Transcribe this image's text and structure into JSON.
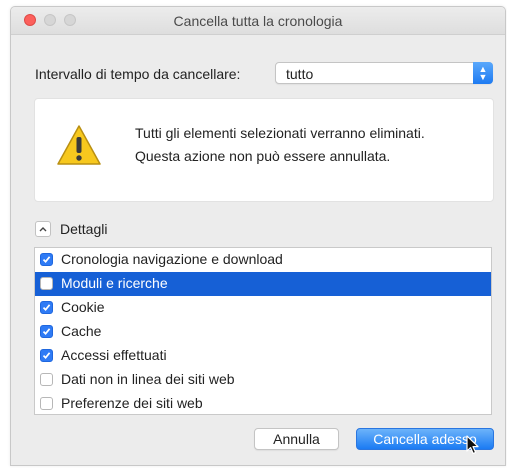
{
  "window": {
    "title": "Cancella tutta la cronologia"
  },
  "range": {
    "label": "Intervallo di tempo da cancellare:",
    "selected": "tutto"
  },
  "warning": {
    "line1": "Tutti gli elementi selezionati verranno eliminati.",
    "line2": "Questa azione non può essere annullata."
  },
  "details": {
    "label": "Dettagli",
    "items": [
      {
        "label": "Cronologia navigazione e download",
        "checked": true,
        "selected": false
      },
      {
        "label": "Moduli e ricerche",
        "checked": false,
        "selected": true
      },
      {
        "label": "Cookie",
        "checked": true,
        "selected": false
      },
      {
        "label": "Cache",
        "checked": true,
        "selected": false
      },
      {
        "label": "Accessi effettuati",
        "checked": true,
        "selected": false
      },
      {
        "label": "Dati non in linea dei siti web",
        "checked": false,
        "selected": false
      },
      {
        "label": "Preferenze dei siti web",
        "checked": false,
        "selected": false
      }
    ]
  },
  "buttons": {
    "cancel": "Annulla",
    "confirm": "Cancella adesso"
  },
  "colors": {
    "accent": "#1f7bf2",
    "selection": "#1660d6",
    "close_button": "#fc605c",
    "warning_yellow": "#f5c518"
  },
  "icons": {
    "warning": "warning-triangle-icon",
    "disclosure": "chevron-up-icon",
    "select_arrows": "up-down-arrows-icon",
    "pointer": "mouse-pointer-icon"
  }
}
